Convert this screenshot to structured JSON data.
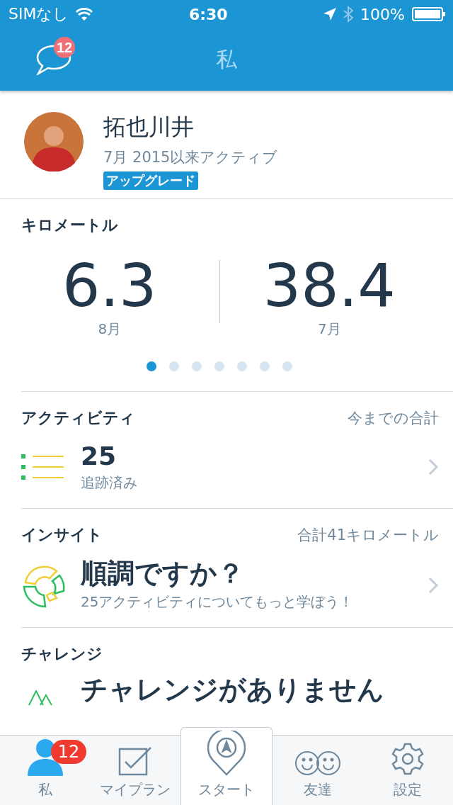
{
  "status_bar": {
    "carrier": "SIMなし",
    "time": "6:30",
    "battery": "100%"
  },
  "nav": {
    "title": "私",
    "message_badge": "12"
  },
  "profile": {
    "name": "拓也川井",
    "since": "7月 2015以来アクティブ",
    "upgrade": "アップグレード"
  },
  "distance": {
    "title": "キロメートル",
    "stats": [
      {
        "value": "6.3",
        "label": "8月"
      },
      {
        "value": "38.4",
        "label": "7月"
      }
    ],
    "pages": [
      {
        "selected": true
      },
      {
        "selected": false
      },
      {
        "selected": false
      },
      {
        "selected": false
      },
      {
        "selected": false
      },
      {
        "selected": false
      },
      {
        "selected": false
      }
    ]
  },
  "sections": [
    {
      "kind": "activity",
      "title": "アクティビティ",
      "aside": "今までの合計",
      "headline": "25",
      "detail": "追跡済み"
    },
    {
      "kind": "insight",
      "title": "インサイト",
      "aside": "合計41キロメートル",
      "headline": "順調ですか？",
      "detail": "25アクティビティについてもっと学ぼう！"
    },
    {
      "kind": "challenge",
      "title": "チャレンジ",
      "headline": "チャレンジがありません"
    }
  ],
  "tab_bar": [
    {
      "kind": "me",
      "label": "私",
      "badge": "12",
      "selected": true
    },
    {
      "kind": "plan",
      "label": "マイプラン",
      "selected": false
    },
    {
      "kind": "start",
      "label": "スタート",
      "selected": false
    },
    {
      "kind": "friends",
      "label": "友達",
      "selected": false
    },
    {
      "kind": "settings",
      "label": "設定",
      "selected": false
    }
  ]
}
